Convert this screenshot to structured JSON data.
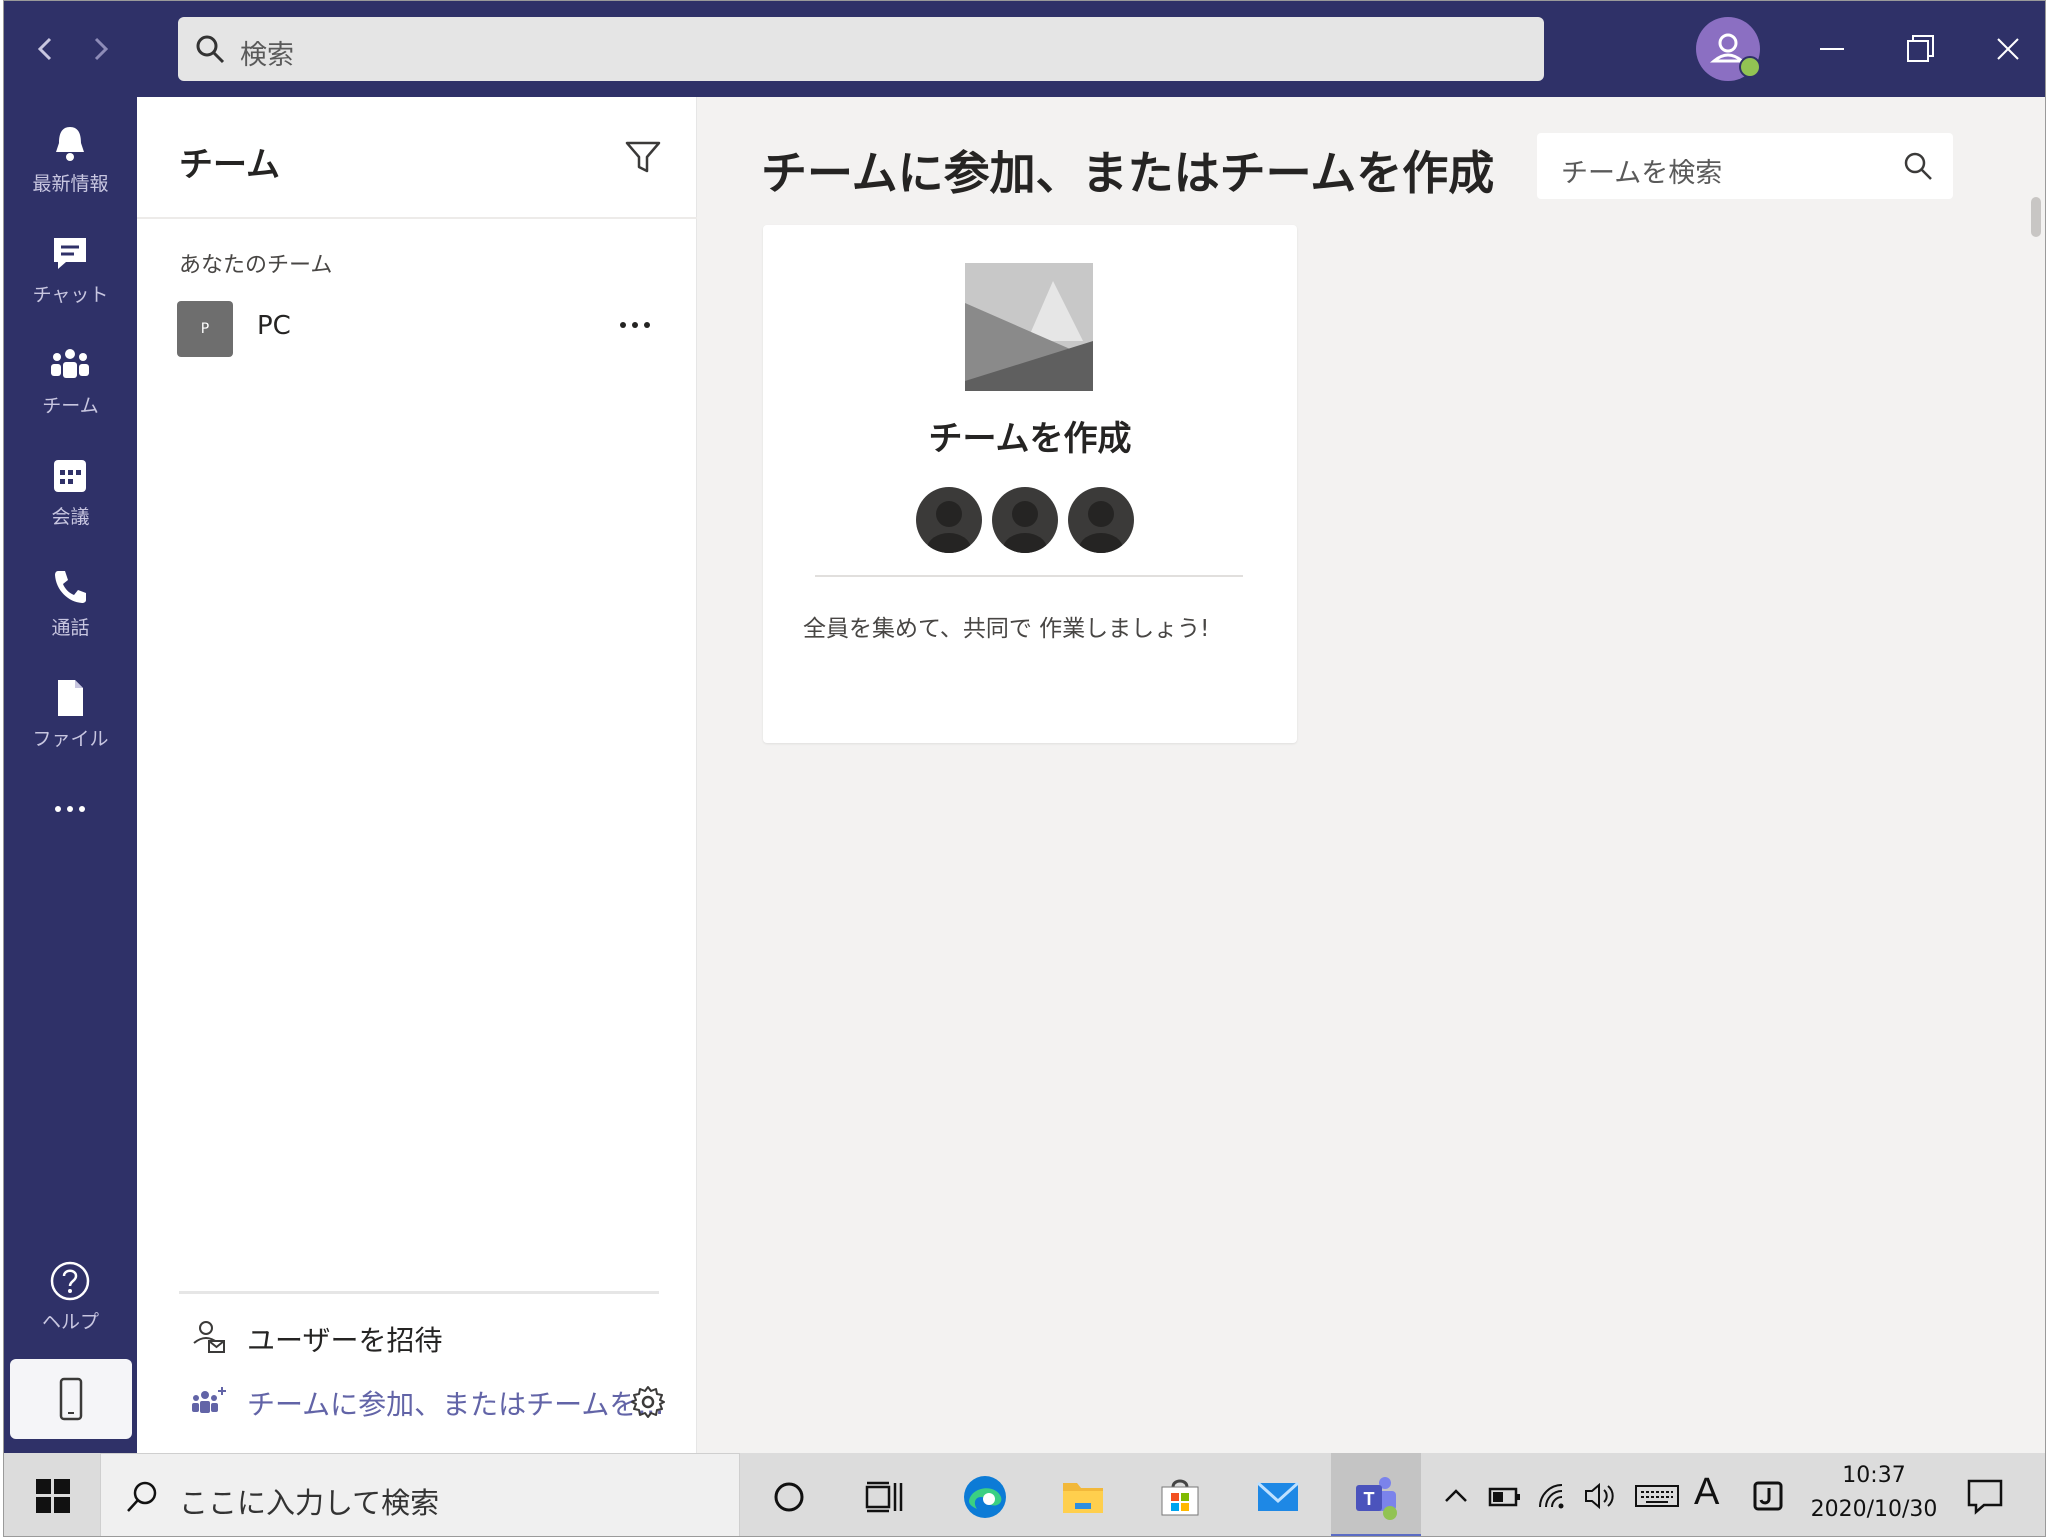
{
  "titlebar": {
    "search_placeholder": "検索",
    "status_color": "#92c353",
    "icons": [
      "chevron-left-icon",
      "chevron-right-icon",
      "search-icon",
      "profile-avatar",
      "minimize-icon",
      "restore-icon",
      "close-icon"
    ]
  },
  "rail": {
    "items": [
      {
        "label": "最新情報",
        "icon": "bell-icon"
      },
      {
        "label": "チャット",
        "icon": "chat-icon"
      },
      {
        "label": "チーム",
        "icon": "teams-icon"
      },
      {
        "label": "会議",
        "icon": "calendar-icon"
      },
      {
        "label": "通話",
        "icon": "phone-icon"
      },
      {
        "label": "ファイル",
        "icon": "file-icon"
      },
      {
        "label": "",
        "icon": "more-icon"
      }
    ],
    "help_label": "ヘルプ",
    "device_icon": "mobile-icon"
  },
  "team_panel": {
    "title": "チーム",
    "section_heading": "あなたのチーム",
    "teams": [
      {
        "initial": "P",
        "name": "PC"
      }
    ],
    "invite_label": "ユーザーを招待",
    "join_label": "チームに参加、またはチームを..."
  },
  "main": {
    "title": "チームに参加、またはチームを作成",
    "search_placeholder": "チームを検索",
    "card": {
      "title": "チームを作成",
      "description": "全員を集めて、共同で 作業しましょう!"
    }
  },
  "taskbar": {
    "search_placeholder": "ここに入力して検索",
    "ime_indicator": "A",
    "time": "10:37",
    "date": "2020/10/30",
    "accent_color": "#5b6cc4"
  },
  "colors": {
    "chrome": "#2f3168",
    "brand": "#6264a7",
    "background": "#f3f2f1"
  }
}
